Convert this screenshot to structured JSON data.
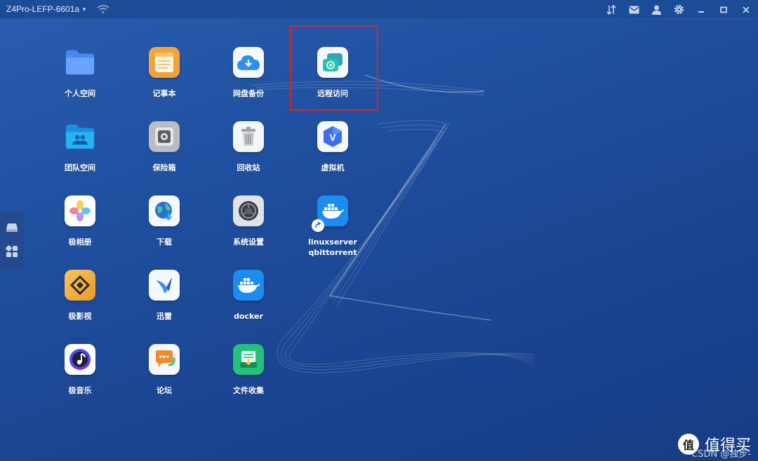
{
  "titlebar": {
    "device_name": "Z4Pro-LEFP-6601a",
    "icons": [
      "transfer-icon",
      "mail-icon",
      "user-icon",
      "gear-icon",
      "minimize-icon",
      "maximize-icon",
      "close-icon"
    ]
  },
  "apps": [
    {
      "label": "个人空间",
      "icon": "folder-icon"
    },
    {
      "label": "记事本",
      "icon": "notepad-icon"
    },
    {
      "label": "网盘备份",
      "icon": "cloud-download-icon"
    },
    {
      "label": "远程访问",
      "icon": "remote-access-icon"
    },
    {
      "label": "团队空间",
      "icon": "team-folder-icon"
    },
    {
      "label": "保险箱",
      "icon": "safe-icon"
    },
    {
      "label": "回收站",
      "icon": "trash-icon"
    },
    {
      "label": "虚拟机",
      "icon": "vm-icon"
    },
    {
      "label": "极相册",
      "icon": "photos-icon"
    },
    {
      "label": "下载",
      "icon": "download-globe-icon"
    },
    {
      "label": "系统设置",
      "icon": "system-settings-icon"
    },
    {
      "label": "linuxserver\nqbittorrent",
      "icon": "docker-app-icon"
    },
    {
      "label": "极影视",
      "icon": "video-icon"
    },
    {
      "label": "迅雷",
      "icon": "thunder-icon"
    },
    {
      "label": "docker",
      "icon": "docker-icon"
    },
    {
      "label": "极音乐",
      "icon": "music-icon"
    },
    {
      "label": "论坛",
      "icon": "forum-icon"
    },
    {
      "label": "文件收集",
      "icon": "file-collect-icon"
    }
  ],
  "dock": {
    "icons": [
      "drive-icon",
      "apps-grid-icon"
    ]
  },
  "watermark": {
    "text": "值得买",
    "sub": "CSDN @独步-",
    "logo_char": "值"
  },
  "colors": {
    "highlight": "#d4262e",
    "background": "#1f4f9f"
  }
}
